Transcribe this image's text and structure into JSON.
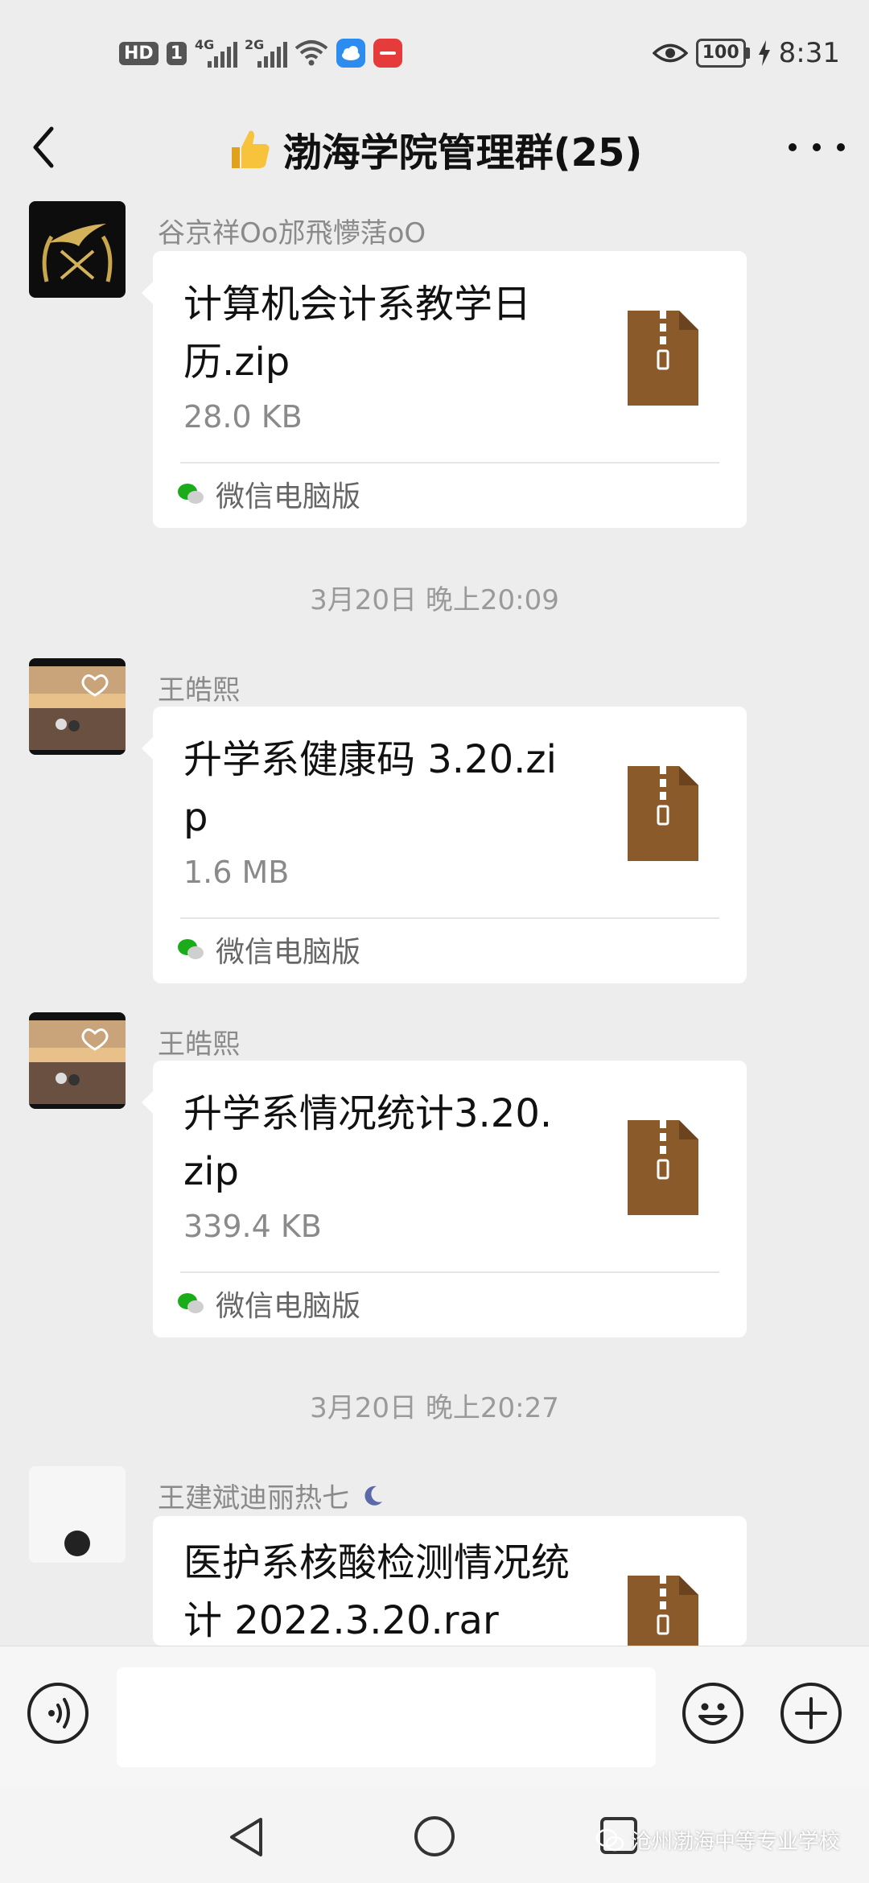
{
  "status_bar": {
    "hd": "HD",
    "sim1_network": "4G",
    "sim2_network": "2G",
    "battery": "100",
    "time": "8:31"
  },
  "header": {
    "title": "渤海学院管理群(25)",
    "title_icon": "thumbs-up-emoji"
  },
  "messages": [
    {
      "sender": "谷京祥Oo邡飛懜萿oO",
      "file_name": "计算机会计系教学日历.zip",
      "file_size": "28.0 KB",
      "source": "微信电脑版"
    },
    {
      "timestamp": "3月20日 晚上20:09",
      "sender": "王皓熙",
      "file_name": "升学系健康码 3.20.zip",
      "file_size": "1.6 MB",
      "source": "微信电脑版"
    },
    {
      "sender": "王皓熙",
      "file_name": "升学系情况统计3.20.zip",
      "file_size": "339.4 KB",
      "source": "微信电脑版"
    },
    {
      "timestamp": "3月20日 晚上20:27",
      "sender": "王建斌迪丽热七",
      "sender_badge": "moon-icon",
      "file_name": "医护系核酸检测情况统计 2022.3.20.rar"
    }
  ],
  "input_bar": {
    "placeholder": ""
  },
  "watermark": {
    "text": "沧州渤海中等专业学校"
  },
  "colors": {
    "background": "#ededed",
    "bubble": "#ffffff",
    "zip_icon": "#8b5a2b",
    "wechat_green": "#1aad19"
  }
}
